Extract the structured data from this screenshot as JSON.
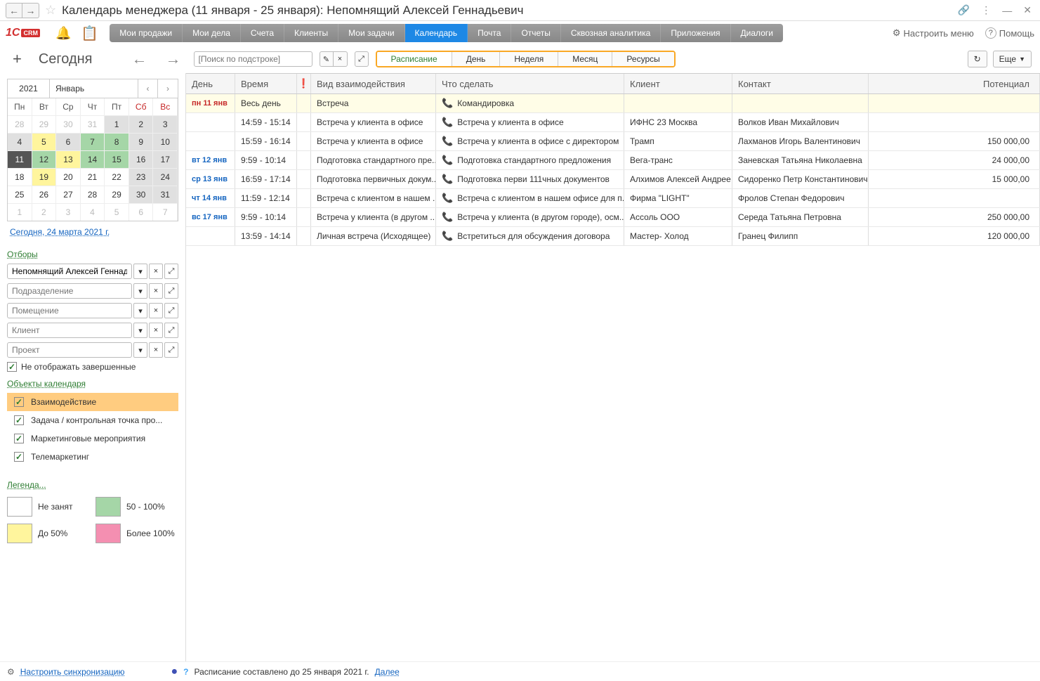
{
  "titlebar": {
    "title": "Календарь менеджера (11 января - 25 января): Непомнящий Алексей Геннадьевич"
  },
  "menubar": {
    "tabs": [
      {
        "label": "Мои продажи"
      },
      {
        "label": "Мои дела"
      },
      {
        "label": "Счета"
      },
      {
        "label": "Клиенты"
      },
      {
        "label": "Мои задачи"
      },
      {
        "label": "Календарь"
      },
      {
        "label": "Почта"
      },
      {
        "label": "Отчеты"
      },
      {
        "label": "Сквозная аналитика"
      },
      {
        "label": "Приложения"
      },
      {
        "label": "Диалоги"
      }
    ],
    "active_index": 5,
    "configure": "Настроить меню",
    "help": "Помощь"
  },
  "toolbar": {
    "today": "Сегодня",
    "search_placeholder": "[Поиск по подстроке]",
    "views": [
      "Расписание",
      "День",
      "Неделя",
      "Месяц",
      "Ресурсы"
    ],
    "more": "Еще"
  },
  "minical": {
    "year": "2021",
    "month": "Январь",
    "dow": [
      "Пн",
      "Вт",
      "Ср",
      "Чт",
      "Пт",
      "Сб",
      "Вс"
    ],
    "weeks": [
      [
        {
          "d": "28",
          "cls": "other"
        },
        {
          "d": "29",
          "cls": "other"
        },
        {
          "d": "30",
          "cls": "other"
        },
        {
          "d": "31",
          "cls": "other"
        },
        {
          "d": "1",
          "cls": "gray"
        },
        {
          "d": "2",
          "cls": "gray"
        },
        {
          "d": "3",
          "cls": "gray"
        }
      ],
      [
        {
          "d": "4",
          "cls": "gray"
        },
        {
          "d": "5",
          "cls": "yellow"
        },
        {
          "d": "6",
          "cls": "gray"
        },
        {
          "d": "7",
          "cls": "green"
        },
        {
          "d": "8",
          "cls": "green"
        },
        {
          "d": "9",
          "cls": "gray"
        },
        {
          "d": "10",
          "cls": "gray"
        }
      ],
      [
        {
          "d": "11",
          "cls": "selected"
        },
        {
          "d": "12",
          "cls": "green"
        },
        {
          "d": "13",
          "cls": "yellow"
        },
        {
          "d": "14",
          "cls": "green"
        },
        {
          "d": "15",
          "cls": "green"
        },
        {
          "d": "16",
          "cls": "gray"
        },
        {
          "d": "17",
          "cls": "gray"
        }
      ],
      [
        {
          "d": "18",
          "cls": ""
        },
        {
          "d": "19",
          "cls": "yellow"
        },
        {
          "d": "20",
          "cls": ""
        },
        {
          "d": "21",
          "cls": ""
        },
        {
          "d": "22",
          "cls": ""
        },
        {
          "d": "23",
          "cls": "gray"
        },
        {
          "d": "24",
          "cls": "gray"
        }
      ],
      [
        {
          "d": "25",
          "cls": ""
        },
        {
          "d": "26",
          "cls": ""
        },
        {
          "d": "27",
          "cls": ""
        },
        {
          "d": "28",
          "cls": ""
        },
        {
          "d": "29",
          "cls": ""
        },
        {
          "d": "30",
          "cls": "gray"
        },
        {
          "d": "31",
          "cls": "gray"
        }
      ],
      [
        {
          "d": "1",
          "cls": "other"
        },
        {
          "d": "2",
          "cls": "other"
        },
        {
          "d": "3",
          "cls": "other"
        },
        {
          "d": "4",
          "cls": "other"
        },
        {
          "d": "5",
          "cls": "other"
        },
        {
          "d": "6",
          "cls": "other"
        },
        {
          "d": "7",
          "cls": "other"
        }
      ]
    ],
    "today_link": "Сегодня, 24 марта 2021 г."
  },
  "filters": {
    "label": "Отборы",
    "manager": "Непомнящий Алексей Геннадье",
    "dept_ph": "Подразделение",
    "room_ph": "Помещение",
    "client_ph": "Клиент",
    "project_ph": "Проект",
    "hide_completed": "Не отображать завершенные"
  },
  "objects": {
    "label": "Объекты календаря",
    "items": [
      {
        "label": "Взаимодействие",
        "checked": true,
        "active": true
      },
      {
        "label": "Задача / контрольная точка про...",
        "checked": true
      },
      {
        "label": "Маркетинговые мероприятия",
        "checked": true
      },
      {
        "label": "Телемаркетинг",
        "checked": true
      }
    ]
  },
  "legend": {
    "label": "Легенда...",
    "items": [
      {
        "color": "#ffffff",
        "text": "Не занят"
      },
      {
        "color": "#a5d6a7",
        "text": "50 - 100%"
      },
      {
        "color": "#fff59d",
        "text": "До 50%"
      },
      {
        "color": "#f48fb1",
        "text": "Более 100%"
      }
    ]
  },
  "grid": {
    "headers": {
      "day": "День",
      "time": "Время",
      "type": "Вид взаимодействия",
      "what": "Что сделать",
      "client": "Клиент",
      "contact": "Контакт",
      "potential": "Потенциал"
    },
    "rows": [
      {
        "day": "пн 11 янв",
        "day_cls": "red",
        "time": "Весь день",
        "type": "Встреча",
        "what": "Командировка",
        "client": "",
        "contact": "",
        "potential": "",
        "highlight": true
      },
      {
        "day": "",
        "time": "14:59 - 15:14",
        "type": "Встреча у клиента в офисе",
        "what": "Встреча у клиента в офисе",
        "client": "ИФНС 23 Москва",
        "contact": "Волков Иван Михайлович",
        "potential": ""
      },
      {
        "day": "",
        "time": "15:59 - 16:14",
        "type": "Встреча у клиента в офисе",
        "what": "Встреча у клиента в офисе с директором",
        "client": "Трамп",
        "contact": "Лахманов Игорь Валентинович",
        "potential": "150 000,00"
      },
      {
        "day": "вт 12 янв",
        "day_cls": "blue",
        "time": "9:59 - 10:14",
        "type": "Подготовка стандартного пре...",
        "what": "Подготовка стандартного предложения",
        "client": "Вега-транс",
        "contact": "Заневская Татьяна Николаевна",
        "potential": "24 000,00"
      },
      {
        "day": "ср 13 янв",
        "day_cls": "blue",
        "time": "16:59 - 17:14",
        "type": "Подготовка первичных докум...",
        "what": "Подготовка перви 111чных документов",
        "client": "Алхимов Алексей Андрее",
        "contact": "Сидоренко Петр Константинович",
        "potential": "15 000,00"
      },
      {
        "day": "чт 14 янв",
        "day_cls": "blue",
        "time": "11:59 - 12:14",
        "type": "Встреча с клиентом в нашем ...",
        "what": "Встреча с клиентом в нашем офисе для п...",
        "client": "Фирма \"LIGHT\"",
        "contact": "Фролов Степан Федорович",
        "potential": ""
      },
      {
        "day": "вс 17 янв",
        "day_cls": "blue",
        "time": "9:59 - 10:14",
        "type": "Встреча у клиента (в другом ...",
        "what": "Встреча у клиента (в другом городе), осм...",
        "client": "Ассоль ООО",
        "contact": "Середа Татьяна Петровна",
        "potential": "250 000,00"
      },
      {
        "day": "",
        "time": "13:59 - 14:14",
        "type": "Личная встреча (Исходящее)",
        "what": "Встретиться для обсуждения договора",
        "client": "Мастер- Холод",
        "contact": "Гранец Филипп",
        "potential": "120 000,00"
      }
    ]
  },
  "footer": {
    "sync": "Настроить синхронизацию",
    "schedule_text": "Расписание составлено до 25 января 2021 г.",
    "next": "Далее"
  }
}
